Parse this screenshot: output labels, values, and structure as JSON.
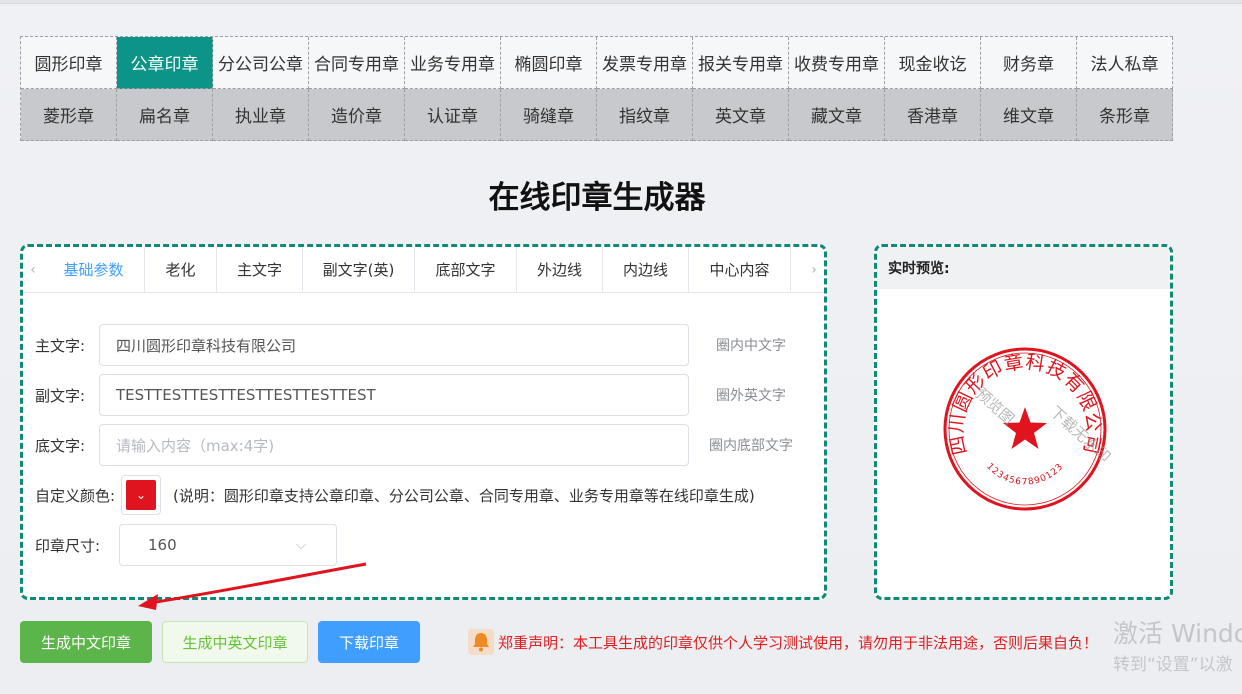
{
  "stamp_types": {
    "row1": [
      "圆形印章",
      "公章印章",
      "分公司公章",
      "合同专用章",
      "业务专用章",
      "椭圆印章",
      "发票专用章",
      "报关专用章",
      "收费专用章",
      "现金收讫",
      "财务章",
      "法人私章"
    ],
    "row2": [
      "菱形章",
      "扁名章",
      "执业章",
      "造价章",
      "认证章",
      "骑缝章",
      "指纹章",
      "英文章",
      "藏文章",
      "香港章",
      "维文章",
      "条形章"
    ],
    "active": "公章印章"
  },
  "page_title": "在线印章生成器",
  "tabs": [
    "基础参数",
    "老化",
    "主文字",
    "副文字(英)",
    "底部文字",
    "外边线",
    "内边线",
    "中心内容"
  ],
  "active_tab": "基础参数",
  "form": {
    "main_text": {
      "label": "主文字:",
      "value": "四川圆形印章科技有限公司",
      "hint": "圈内中文字"
    },
    "sub_text": {
      "label": "副文字:",
      "value": "TESTTESTTESTTESTTESTTESTTEST",
      "hint": "圈外英文字"
    },
    "bottom_text": {
      "label": "底文字:",
      "placeholder": "请输入内容（max:4字)",
      "hint": "圈内底部文字"
    },
    "color": {
      "label": "自定义颜色:",
      "value": "#e0141e",
      "note": "(说明：圆形印章支持公章印章、分公司公章、合同专用章、业务专用章等在线印章生成)"
    },
    "size": {
      "label": "印章尺寸:",
      "value": "160"
    }
  },
  "preview": {
    "title": "实时预览:",
    "stamp_top_text": "四川圆形印章科技有限公司",
    "stamp_bottom_numbers": "1234567890123",
    "watermark": "下载无水印",
    "watermark2": "预览图",
    "stamp_color": "#e0141e"
  },
  "buttons": {
    "generate_cn": "生成中文印章",
    "generate_cn_en": "生成中英文印章",
    "download": "下载印章"
  },
  "disclaimer": "郑重声明：本工具生成的印章仅供个人学习测试使用，请勿用于非法用途，否则后果自负！",
  "windows_watermark": {
    "line1": "激活 Windo",
    "line2": "转到“设置”以激"
  },
  "colors": {
    "teal": "#0d9488",
    "blue": "#409eff",
    "green": "#5cb54a",
    "red": "#e0141e"
  }
}
